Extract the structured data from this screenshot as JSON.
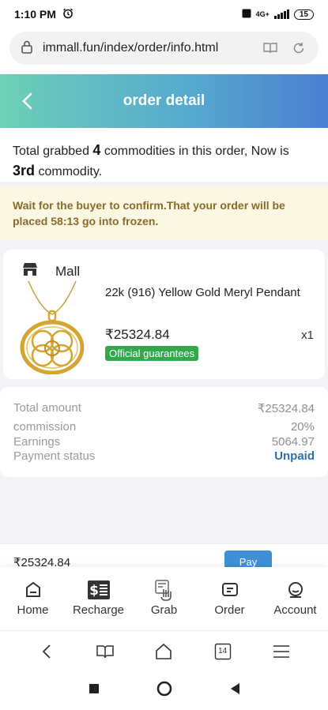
{
  "status_bar": {
    "time": "1:10 PM",
    "network": "4G+",
    "battery": "15"
  },
  "browser": {
    "url": "immall.fun/index/order/info.html",
    "tab_count": "14"
  },
  "header": {
    "title": "order detail"
  },
  "intro": {
    "prefix": "Total grabbed ",
    "count": "4",
    "middle": " commodities in this order, Now is",
    "position": "3rd",
    "suffix": " commodity."
  },
  "notice": {
    "text": "Wait for the buyer to confirm.That your order will be placed 58:13 go into frozen."
  },
  "product": {
    "store": "Mall",
    "name": "22k (916) Yellow Gold Meryl Pendant",
    "price": "₹25324.84",
    "quantity": "x1",
    "badge": "Official guarantees"
  },
  "summary": {
    "total_label": "Total amount",
    "total_value": "₹25324.84",
    "commission_label": "commission",
    "commission_value": "20%",
    "earnings_label": "Earnings",
    "earnings_value": "5064.97",
    "status_label": "Payment status",
    "status_value": "Unpaid"
  },
  "paybar": {
    "total": "₹25324.84",
    "pay_label": "Pay"
  },
  "tabs": [
    {
      "label": "Home",
      "icon": "home-icon"
    },
    {
      "label": "Recharge",
      "icon": "recharge-icon"
    },
    {
      "label": "Grab",
      "icon": "grab-icon"
    },
    {
      "label": "Order",
      "icon": "order-icon"
    },
    {
      "label": "Account",
      "icon": "account-icon"
    }
  ],
  "colors": {
    "header_start": "#6fcfb7",
    "header_end": "#4b7fd1",
    "badge": "#31a84a",
    "unpaid": "#2b6fb4",
    "notice_bg": "#fbf7e3",
    "notice_text": "#8a6a27"
  }
}
